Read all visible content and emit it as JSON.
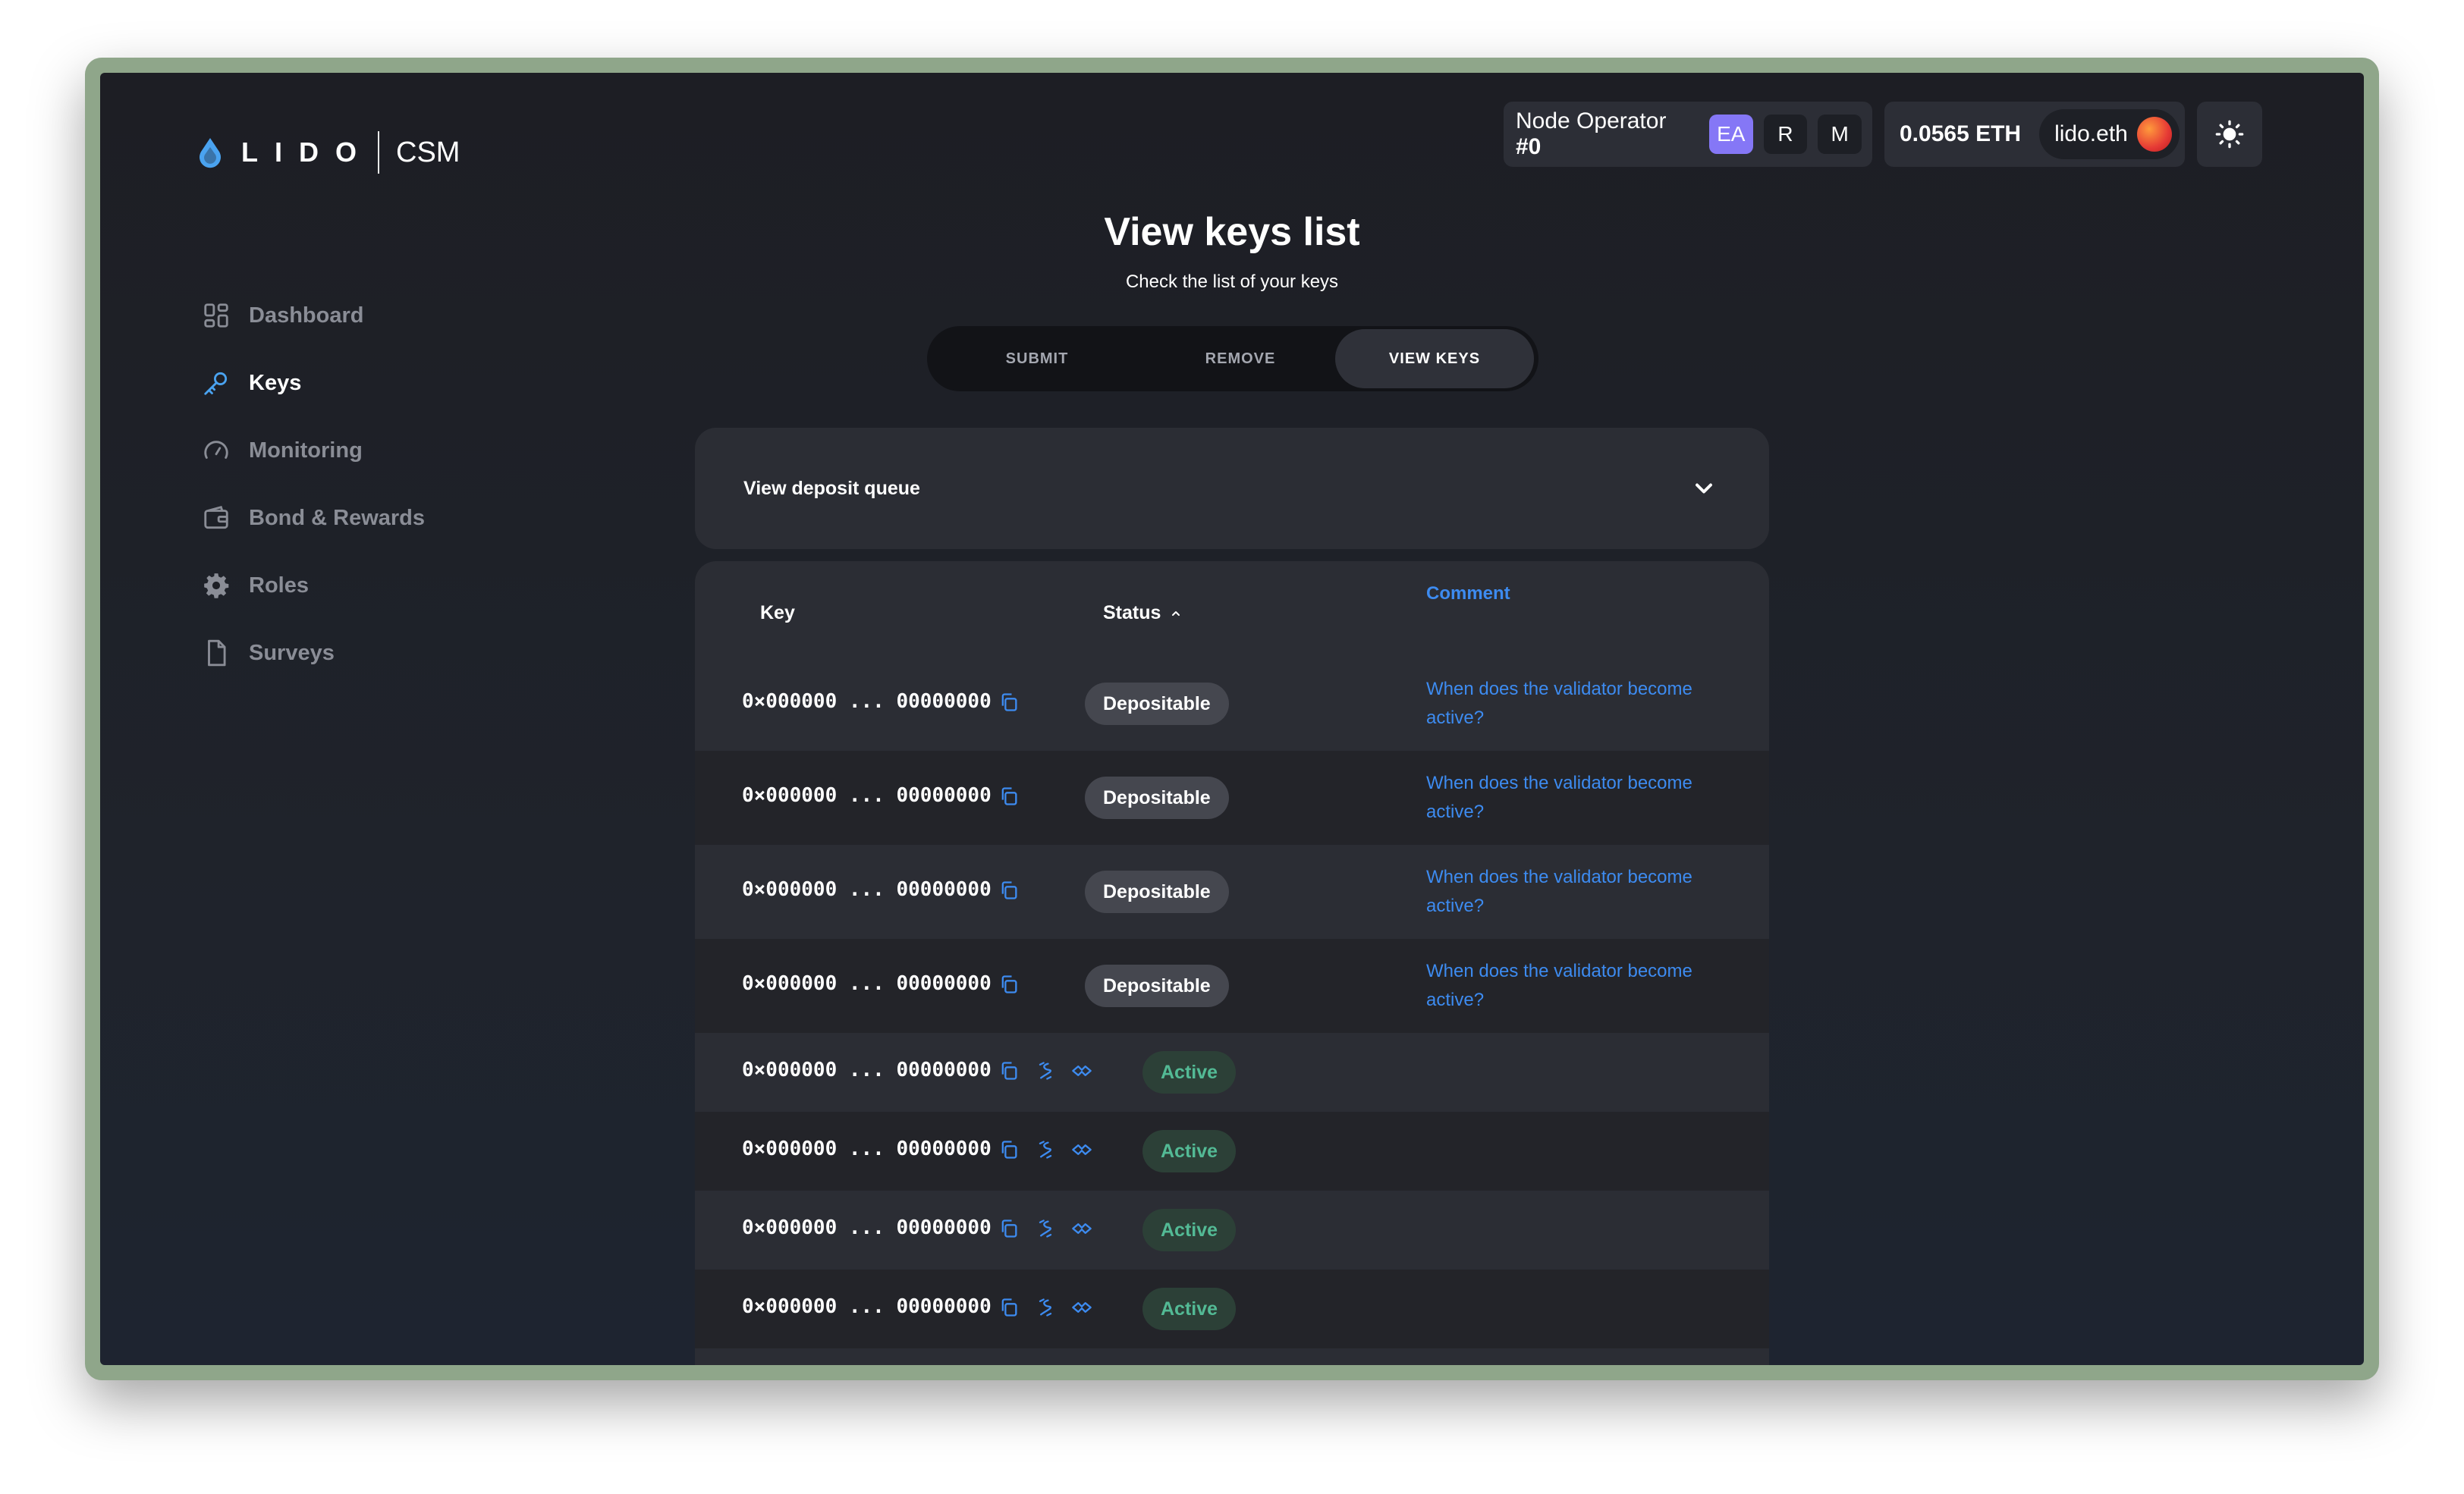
{
  "brand": {
    "logo_text": "LIDO",
    "product": "CSM"
  },
  "nav": {
    "items": [
      {
        "label": "Dashboard",
        "icon": "dashboard-icon",
        "active": false
      },
      {
        "label": "Keys",
        "icon": "key-icon",
        "active": true
      },
      {
        "label": "Monitoring",
        "icon": "gauge-icon",
        "active": false
      },
      {
        "label": "Bond & Rewards",
        "icon": "wallet-icon",
        "active": false
      },
      {
        "label": "Roles",
        "icon": "gear-icon",
        "active": false
      },
      {
        "label": "Surveys",
        "icon": "document-icon",
        "active": false
      }
    ]
  },
  "header": {
    "operator_label": "Node Operator ",
    "operator_id": "#0",
    "roles": [
      "EA",
      "R",
      "M"
    ],
    "balance": "0.0565 ETH",
    "ens_name": "lido.eth",
    "theme_icon": "sun-icon"
  },
  "page": {
    "title": "View keys list",
    "subtitle": "Check the list of your keys"
  },
  "tabs": [
    {
      "label": "SUBMIT",
      "selected": false
    },
    {
      "label": "REMOVE",
      "selected": false
    },
    {
      "label": "VIEW KEYS",
      "selected": true
    }
  ],
  "deposit_queue": {
    "label": "View deposit queue"
  },
  "table": {
    "headers": {
      "key": "Key",
      "status": "Status",
      "comment": "Comment"
    },
    "rows": [
      {
        "key": "0×000000 ... 00000000",
        "status": "Depositable",
        "comment": "When does the validator become active?"
      },
      {
        "key": "0×000000 ... 00000000",
        "status": "Depositable",
        "comment": "When does the validator become active?"
      },
      {
        "key": "0×000000 ... 00000000",
        "status": "Depositable",
        "comment": "When does the validator become active?"
      },
      {
        "key": "0×000000 ... 00000000",
        "status": "Depositable",
        "comment": "When does the validator become active?"
      },
      {
        "key": "0×000000 ... 00000000",
        "status": "Active",
        "comment": ""
      },
      {
        "key": "0×000000 ... 00000000",
        "status": "Active",
        "comment": ""
      },
      {
        "key": "0×000000 ... 00000000",
        "status": "Active",
        "comment": ""
      },
      {
        "key": "0×000000 ... 00000000",
        "status": "Active",
        "comment": ""
      }
    ]
  },
  "colors": {
    "accent": "#3d8bf0",
    "active_badge_text": "#53ba95",
    "role_ea": "#8577f6"
  }
}
